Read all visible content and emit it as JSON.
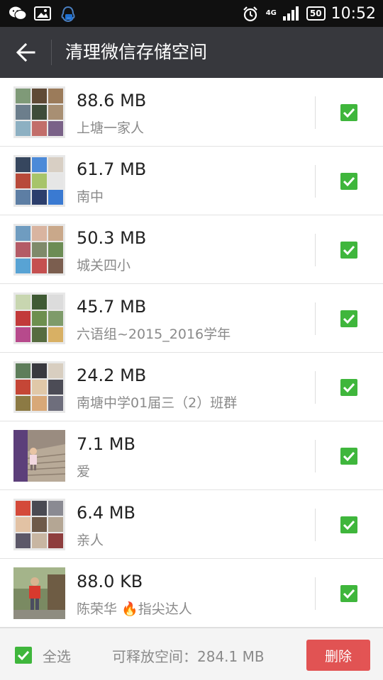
{
  "status_bar": {
    "network": "4G",
    "battery": "50",
    "time": "10:52"
  },
  "header": {
    "title": "清理微信存储空间"
  },
  "items": [
    {
      "size": "88.6 MB",
      "name": "上塘一家人",
      "checked": true
    },
    {
      "size": "61.7 MB",
      "name": "南中",
      "checked": true
    },
    {
      "size": "50.3 MB",
      "name": "城关四小",
      "checked": true
    },
    {
      "size": "45.7 MB",
      "name": "六语组~2015_2016学年",
      "checked": true
    },
    {
      "size": "24.2 MB",
      "name": "南塘中学01届三（2）班群",
      "checked": true
    },
    {
      "size": "7.1 MB",
      "name": "爱",
      "checked": true
    },
    {
      "size": "6.4 MB",
      "name": "亲人",
      "checked": true
    },
    {
      "size": "88.0 KB",
      "name": "陈荣华 🔥指尖达人",
      "checked": true
    }
  ],
  "footer": {
    "select_all_label": "全选",
    "free_space": "可释放空间：284.1 MB",
    "delete_label": "删除"
  }
}
